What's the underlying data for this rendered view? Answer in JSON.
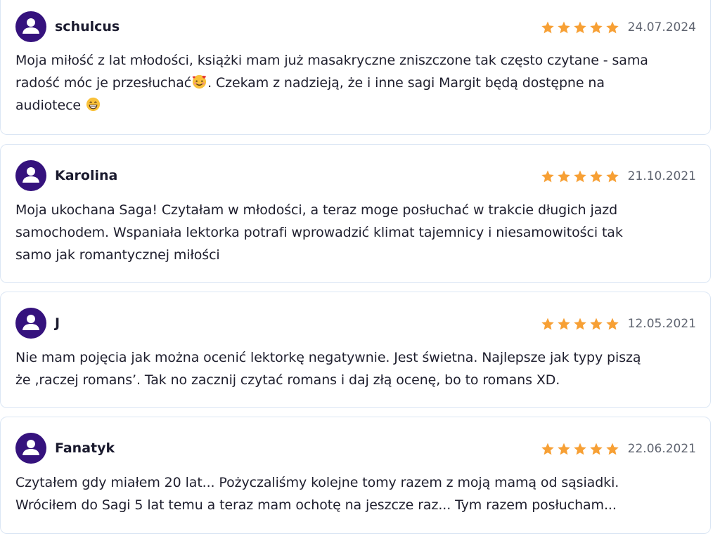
{
  "reviews": [
    {
      "author": "schulcus",
      "date": "24.07.2024",
      "rating": 5,
      "text_lines": [
        "Moja miłość z lat młodości, książki mam już masakryczne zniszczone tak często czytane - sama",
        "radość móc je przesłuchać",
        ". Czekam z nadzieją, że i inne sagi Margit będą dostępne na",
        "audiotece"
      ],
      "emojis": [
        "smiling-face-with-hearts-emoji",
        "grinning-face-emoji"
      ]
    },
    {
      "author": "Karolina",
      "date": "21.10.2021",
      "rating": 5,
      "text_lines": [
        "Moja ukochana Saga! Czytałam w młodości, a teraz moge posłuchać w trakcie długich jazd",
        "samochodem. Wspaniała lektorka potrafi wprowadzić klimat tajemnicy i niesamowitości tak",
        "samo jak romantycznej miłości"
      ]
    },
    {
      "author": "J",
      "date": "12.05.2021",
      "rating": 5,
      "text_lines": [
        "Nie mam pojęcia jak można ocenić lektorkę negatywnie. Jest świetna. Najlepsze jak typy piszą",
        "że ‚raczej romans’. Tak no zacznij czytać romans i daj złą ocenę, bo to romans XD."
      ]
    },
    {
      "author": "Fanatyk",
      "date": "22.06.2021",
      "rating": 5,
      "text_lines": [
        "Czytałem gdy miałem 20 lat... Pożyczaliśmy kolejne tomy razem z moją mamą od sąsiadki.",
        "Wróciłem do Sagi 5 lat temu a teraz mam ochotę na jeszcze raz... Tym razem posłucham..."
      ]
    }
  ],
  "colors": {
    "avatar": "#35127d",
    "star": "#f7a035",
    "card_border": "#dbe6f4",
    "date": "#5f6470"
  },
  "icons": {
    "avatar": "user-avatar-icon",
    "star": "star-icon"
  }
}
